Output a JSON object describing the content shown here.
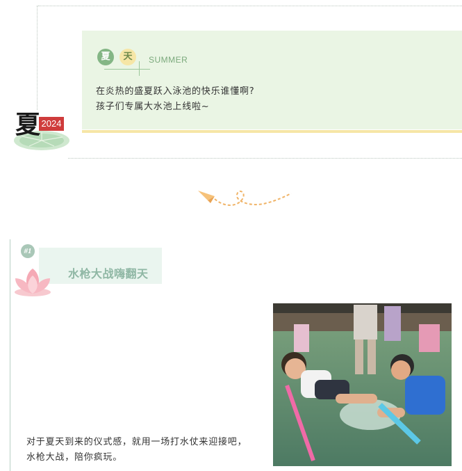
{
  "header": {
    "tag_first": "夏",
    "tag_second": "天",
    "tag_word": "SUMMER",
    "intro_line1": "在炎热的盛夏跃入泳池的快乐谁懂啊?",
    "intro_line2": "孩子们专属大水池上线啦~"
  },
  "emblem": {
    "character": "夏",
    "year": "2024"
  },
  "section1": {
    "number": "#1",
    "title": "水枪大战嗨翻天",
    "paragraph": "对于夏天到来的仪式感，就用一场打水仗来迎接吧，水枪大战，陪你疯玩。",
    "photo_icon": "kids-water-gun-photo"
  },
  "colors": {
    "card_bg": "#eaf5e4",
    "accent_green": "#84b685",
    "accent_yellow": "#f6e6a6",
    "year_red": "#cf3c3c",
    "plane_orange": "#f0b468",
    "section_title": "#8fb7a4"
  }
}
